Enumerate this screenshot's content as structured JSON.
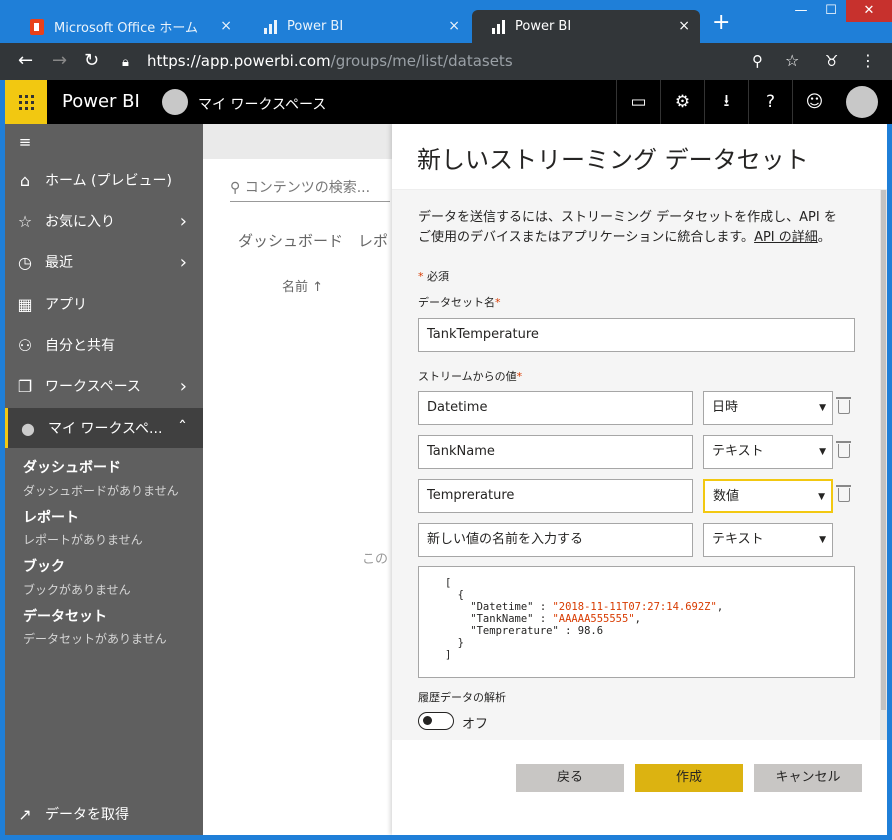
{
  "browser": {
    "tabs": [
      {
        "label": "Microsoft Office ホーム",
        "close": "×"
      },
      {
        "label": "Power BI",
        "close": "×"
      },
      {
        "label": "Power BI",
        "close": "×"
      }
    ],
    "new_tab": "+",
    "window_controls": {
      "minimize": "—",
      "maximize": "☐",
      "close": "✕"
    },
    "url_host": "https://app.powerbi.com",
    "url_path": "/groups/me/list/datasets"
  },
  "header": {
    "app_title": "Power BI",
    "workspace": "マイ ワークスペース"
  },
  "leftnav": {
    "items": [
      {
        "label": "ホーム (プレビュー)",
        "icon": "⌂"
      },
      {
        "label": "お気に入り",
        "icon": "☆"
      },
      {
        "label": "最近",
        "icon": "◷"
      },
      {
        "label": "アプリ",
        "icon": "▦"
      },
      {
        "label": "自分と共有",
        "icon": "⚇"
      },
      {
        "label": "ワークスペース",
        "icon": "❐"
      },
      {
        "label": "マイ ワークスペ...",
        "icon": "●"
      }
    ],
    "sections": [
      {
        "title": "ダッシュボード",
        "empty": "ダッシュボードがありません"
      },
      {
        "title": "レポート",
        "empty": "レポートがありません"
      },
      {
        "title": "ブック",
        "empty": "ブックがありません"
      },
      {
        "title": "データセット",
        "empty": "データセットがありません"
      }
    ],
    "get_data": "データを取得"
  },
  "background": {
    "search_placeholder": "コンテンツの検索...",
    "tabs": "ダッシュボード　レポ",
    "name_col": "名前",
    "empty_text": "この"
  },
  "panel": {
    "title": "新しいストリーミング データセット",
    "description": "データを送信するには、ストリーミング データセットを作成し、API をご使用のデバイスまたはアプリケーションに統合します。",
    "api_link": "API の詳細",
    "required_note": "必須",
    "dataset_name_label": "データセット名",
    "dataset_name_value": "TankTemperature",
    "stream_values_label": "ストリームからの値",
    "fields": [
      {
        "name": "Datetime",
        "type": "日時"
      },
      {
        "name": "TankName",
        "type": "テキスト"
      },
      {
        "name": "Temprerature",
        "type": "数値"
      }
    ],
    "new_field_placeholder": "新しい値の名前を入力する",
    "new_field_type": "テキスト",
    "json_lines": [
      "[",
      "  {",
      "    \"Datetime\" : \"2018-11-11T07:27:14.692Z\",",
      "    \"TankName\" : \"AAAAA555555\",",
      "    \"Temprerature\" : 98.6",
      "  }",
      "]"
    ],
    "history_label": "履歴データの解析",
    "history_state": "オフ",
    "buttons": {
      "back": "戻る",
      "create": "作成",
      "cancel": "キャンセル"
    }
  }
}
